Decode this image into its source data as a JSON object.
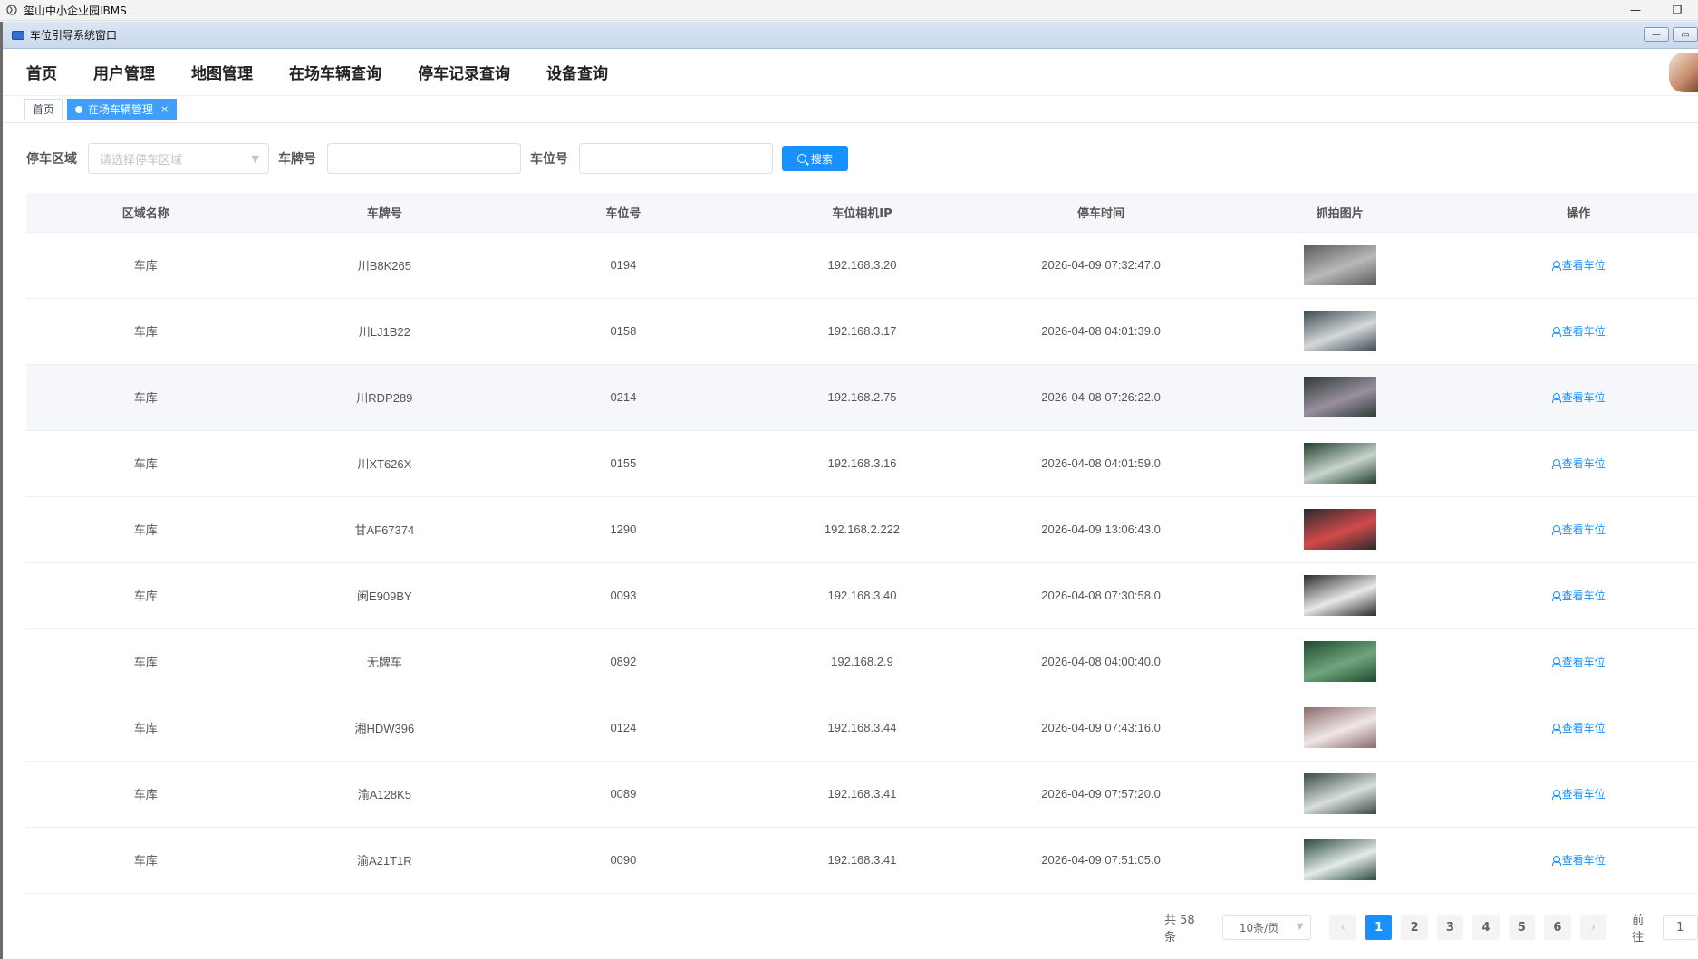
{
  "outer_window": {
    "title": "玺山中小企业园IBMS",
    "minimize_glyph": "—",
    "restore_glyph": "❐"
  },
  "inner_window": {
    "title": "车位引导系统窗口",
    "min_glyph": "—",
    "restore_glyph": "▭"
  },
  "nav": {
    "items": [
      "首页",
      "用户管理",
      "地图管理",
      "在场车辆查询",
      "停车记录查询",
      "设备查询"
    ]
  },
  "tabs": {
    "home": "首页",
    "active": "在场车辆管理",
    "close_glyph": "×"
  },
  "filters": {
    "area_label": "停车区域",
    "area_placeholder": "请选择停车区域",
    "plate_label": "车牌号",
    "plate_value": "",
    "space_label": "车位号",
    "space_value": "",
    "search_label": "搜索"
  },
  "table": {
    "headers": [
      "区域名称",
      "车牌号",
      "车位号",
      "车位相机IP",
      "停车时间",
      "抓拍图片",
      "操作"
    ],
    "action_label": "查看车位",
    "rows": [
      {
        "area": "车库",
        "plate": "川B8K265",
        "space": "0194",
        "ip": "192.168.3.20",
        "time": "2026-04-09 07:32:47.0",
        "thumb_colors": [
          "#5a5a5a",
          "#b9b9b9"
        ]
      },
      {
        "area": "车库",
        "plate": "川LJ1B22",
        "space": "0158",
        "ip": "192.168.3.17",
        "time": "2026-04-08 04:01:39.0",
        "thumb_colors": [
          "#3d4a50",
          "#d4d8da"
        ]
      },
      {
        "area": "车库",
        "plate": "川RDP289",
        "space": "0214",
        "ip": "192.168.2.75",
        "time": "2026-04-08 07:26:22.0",
        "thumb_colors": [
          "#2c3a33",
          "#9a8fa0"
        ]
      },
      {
        "area": "车库",
        "plate": "川XT626X",
        "space": "0155",
        "ip": "192.168.3.16",
        "time": "2026-04-08 04:01:59.0",
        "thumb_colors": [
          "#23402f",
          "#c7d4cc"
        ]
      },
      {
        "area": "车库",
        "plate": "甘AF67374",
        "space": "1290",
        "ip": "192.168.2.222",
        "time": "2026-04-09 13:06:43.0",
        "thumb_colors": [
          "#2a2a2e",
          "#d24a4a"
        ]
      },
      {
        "area": "车库",
        "plate": "闽E909BY",
        "space": "0093",
        "ip": "192.168.3.40",
        "time": "2026-04-08 07:30:58.0",
        "thumb_colors": [
          "#2b2b2b",
          "#e8e8e8"
        ]
      },
      {
        "area": "车库",
        "plate": "无牌车",
        "space": "0892",
        "ip": "192.168.2.9",
        "time": "2026-04-08 04:00:40.0",
        "thumb_colors": [
          "#1f4a2c",
          "#6fa57e"
        ]
      },
      {
        "area": "车库",
        "plate": "湘HDW396",
        "space": "0124",
        "ip": "192.168.3.44",
        "time": "2026-04-09 07:43:16.0",
        "thumb_colors": [
          "#8a6b6b",
          "#f0e6e6"
        ]
      },
      {
        "area": "车库",
        "plate": "渝A128K5",
        "space": "0089",
        "ip": "192.168.3.41",
        "time": "2026-04-09 07:57:20.0",
        "thumb_colors": [
          "#3a4a44",
          "#d8dedb"
        ]
      },
      {
        "area": "车库",
        "plate": "渝A21T1R",
        "space": "0090",
        "ip": "192.168.3.41",
        "time": "2026-04-09 07:51:05.0",
        "thumb_colors": [
          "#2c4a3e",
          "#e3ebe7"
        ]
      }
    ]
  },
  "pagination": {
    "total_text": "共 58 条",
    "page_size": "10条/页",
    "prev_glyph": "‹",
    "next_glyph": "›",
    "pages": [
      "1",
      "2",
      "3",
      "4",
      "5",
      "6"
    ],
    "current_page": "1",
    "jump_label": "前往",
    "jump_value": "1"
  },
  "colors": {
    "primary": "#1890ff",
    "tab_active": "#409eff",
    "header_bg": "#f5f7fa"
  }
}
